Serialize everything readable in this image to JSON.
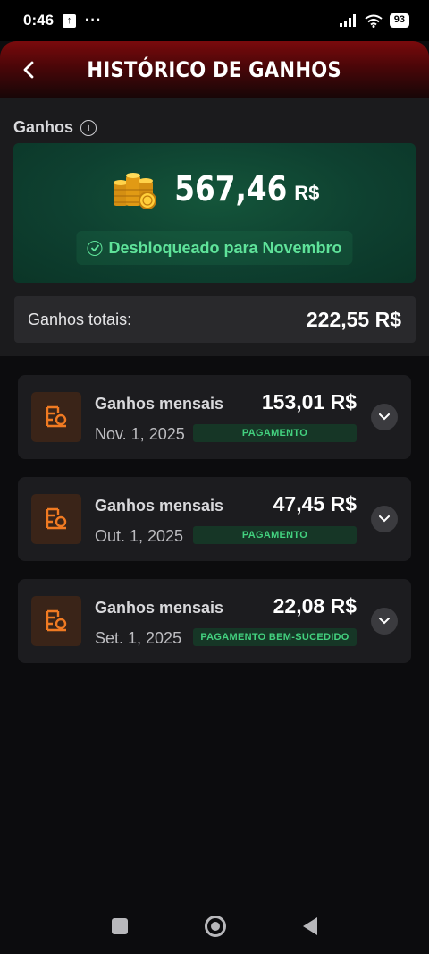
{
  "status_bar": {
    "time": "0:46",
    "upload_glyph": "↑",
    "dots": "···",
    "battery": "93"
  },
  "header": {
    "title": "HISTÓRICO DE GANHOS"
  },
  "earnings": {
    "label": "Ganhos",
    "balance": "567,46",
    "currency": "R$",
    "unlock_text": "Desbloqueado para Novembro",
    "total_label": "Ganhos totais:",
    "total_value": "222,55 R$"
  },
  "entries": [
    {
      "title": "Ganhos mensais",
      "amount": "153,01 R$",
      "date": "Nov. 1, 2025",
      "status": "PAGAMENTO"
    },
    {
      "title": "Ganhos mensais",
      "amount": "47,45 R$",
      "date": "Out. 1, 2025",
      "status": "PAGAMENTO"
    },
    {
      "title": "Ganhos mensais",
      "amount": "22,08 R$",
      "date": "Set. 1, 2025",
      "status": "PAGAMENTO BEM-SUCEDIDO"
    }
  ],
  "colors": {
    "header_red": "#7a0a0c",
    "card_green": "#0e4030",
    "status_green": "#43d17f",
    "icon_orange": "#f07a22"
  },
  "icons": {
    "back": "chevron-left-icon",
    "info": "info-icon",
    "coins": "coin-stack-icon",
    "check": "check-circle-icon",
    "entry": "earnings-document-icon",
    "expand": "chevron-down-icon"
  }
}
